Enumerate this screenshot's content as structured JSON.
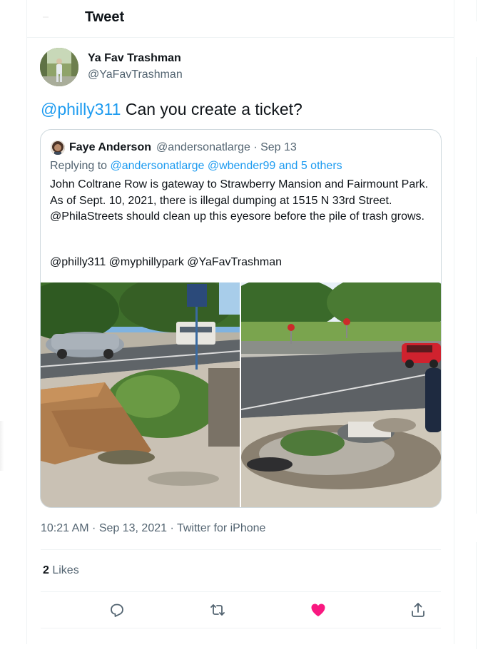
{
  "header": {
    "title": "Tweet"
  },
  "tweet": {
    "author_name": "Ya Fav Trashman",
    "author_handle": "@YaFavTrashman",
    "mention": "@philly311",
    "text": " Can you create a ticket?",
    "timestamp": "10:21 AM · Sep 13, 2021 · Twitter for iPhone",
    "likes_count": "2",
    "likes_label": " Likes"
  },
  "quote": {
    "author_name": "Faye Anderson",
    "meta": "@andersonatlarge · Sep 13",
    "replying_prefix": "Replying to ",
    "replying_to": "@andersonatlarge @wbender99 and 5 others",
    "body": "John Coltrane Row is gateway to Strawberry Mansion and Fairmount Park. As of Sept. 10, 2021, there is illegal dumping at 1515 N 33rd Street. @PhilaStreets should clean up this eyesore before the pile of trash grows.",
    "tags": "@philly311 @myphillypark @YaFavTrashman"
  },
  "actions": {
    "reply_icon": "reply-icon",
    "retweet_icon": "retweet-icon",
    "like_icon": "heart-icon",
    "share_icon": "share-icon"
  },
  "colors": {
    "link": "#1d9bf0",
    "secondary_text": "#536471",
    "like": "#f91880",
    "border": "#cfd9de"
  }
}
